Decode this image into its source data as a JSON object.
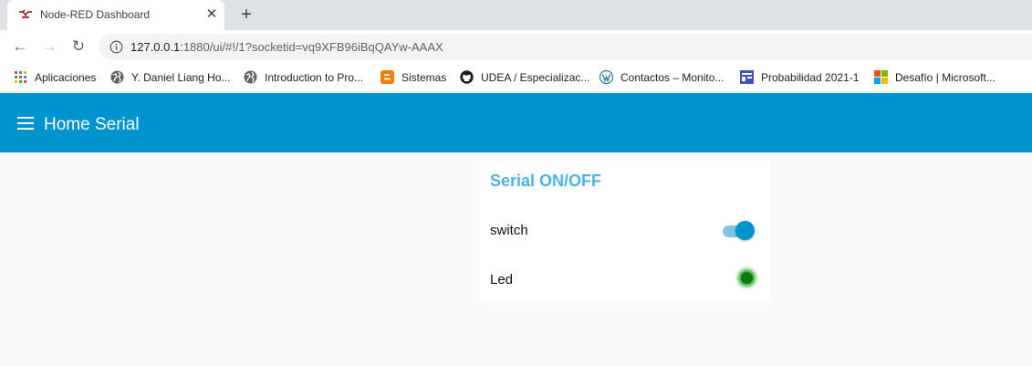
{
  "browser": {
    "tab": {
      "title": "Node-RED Dashboard",
      "close_label": "✕"
    },
    "new_tab_label": "+",
    "nav": {
      "back": "←",
      "forward": "→",
      "reload": "↻"
    },
    "url": {
      "host": "127.0.0.1",
      "path": ":1880/ui/#!/1?socketid=vq9XFB96iBqQAYw-AAAX"
    },
    "bookmarks": [
      {
        "label": "Aplicaciones",
        "icon": "apps-grid-icon"
      },
      {
        "label": "Y. Daniel Liang Ho...",
        "icon": "globe-icon"
      },
      {
        "label": "Introduction to Pro...",
        "icon": "globe-icon"
      },
      {
        "label": "Sistemas",
        "icon": "blogger-icon"
      },
      {
        "label": "UDEA / Especializac...",
        "icon": "github-icon"
      },
      {
        "label": "Contactos – Monito...",
        "icon": "wordpress-icon"
      },
      {
        "label": "Probabilidad 2021-1",
        "icon": "forms-icon"
      },
      {
        "label": "Desafío | Microsoft...",
        "icon": "microsoft-icon"
      }
    ]
  },
  "dashboard": {
    "title": "Home Serial",
    "header_color": "#0094ce",
    "group": {
      "title": "Serial ON/OFF",
      "title_color": "#4ab4e6",
      "switch": {
        "label": "switch",
        "state": "on",
        "color": "#0094ce"
      },
      "led": {
        "label": "Led",
        "state": "on",
        "color": "#0a7a0a"
      }
    }
  }
}
